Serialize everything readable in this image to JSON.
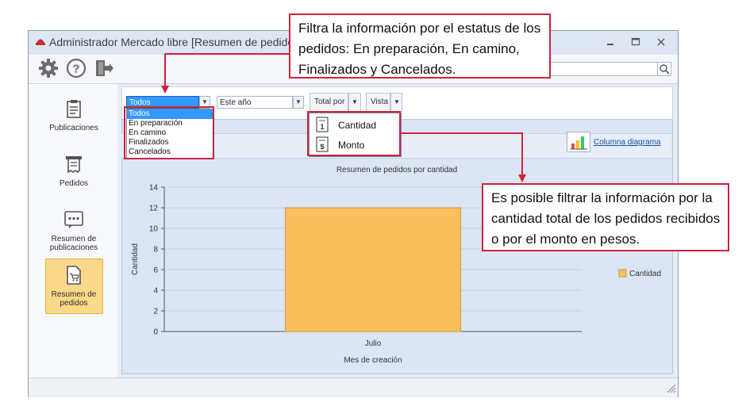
{
  "window": {
    "title": "Administrador Mercado libre [Resumen de pedidos]",
    "minimize_label": "▭",
    "maximize_label": "□",
    "close_label": "✕"
  },
  "sidebar": {
    "items": [
      {
        "label": "Publicaciones"
      },
      {
        "label": "Pedidos"
      },
      {
        "label": "Resumen de publicaciones"
      },
      {
        "label": "Resumen de pedidos"
      }
    ]
  },
  "filters": {
    "status_selected": "Todos",
    "status_options": [
      "Todos",
      "En preparación",
      "En camino",
      "Finalizados",
      "Cancelados"
    ],
    "period_selected": "Este año",
    "total_por_label": "Total por",
    "vista_label": "Vista",
    "total_por_options": [
      "Cantidad",
      "Monto"
    ]
  },
  "chart_header": {
    "link_label": "Columna diagrama"
  },
  "chart_data": {
    "type": "bar",
    "title": "Resumen de pedidos por cantidad",
    "categories": [
      "Julio"
    ],
    "series": [
      {
        "name": "Cantidad",
        "values": [
          12
        ]
      }
    ],
    "xlabel": "Mes de creación",
    "ylabel": "Cantidad",
    "ylim": [
      0,
      14
    ],
    "yticks": [
      0,
      2,
      4,
      6,
      8,
      10,
      12,
      14
    ],
    "grid": true,
    "legend": "right",
    "bar_color": "#fbbf5e"
  },
  "callouts": {
    "status_note": "Filtra la información por el estatus de los pedidos: En preparación, En camino, Finalizados y Cancelados.",
    "total_note": "Es posible filtrar la información por la cantidad total de los pedidos recibidos o por el monto en pesos."
  },
  "colors": {
    "accent_red": "#d1223d",
    "selection": "#3399ff",
    "nav_selected": "#fcd88a"
  }
}
